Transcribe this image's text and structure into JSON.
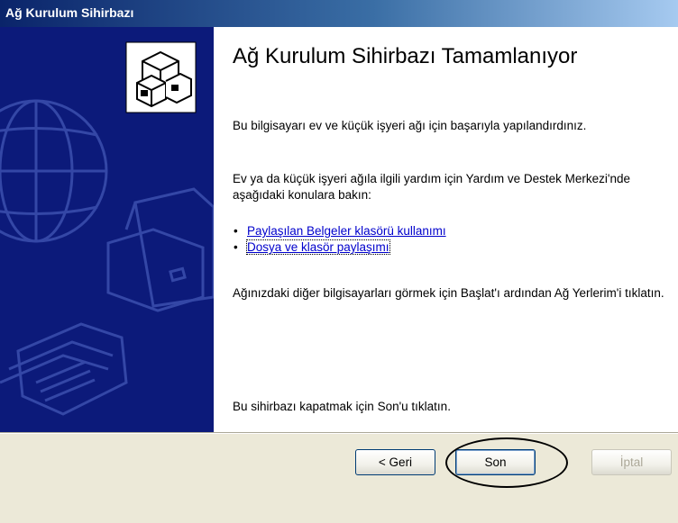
{
  "window": {
    "title": "Ağ Kurulum Sihirbazı"
  },
  "content": {
    "heading": "Ağ Kurulum Sihirbazı Tamamlanıyor",
    "paragraph1": "Bu bilgisayarı ev ve küçük işyeri ağı için başarıyla yapılandırdınız.",
    "paragraph2": "Ev ya da küçük işyeri ağıla ilgili yardım için Yardım ve Destek Merkezi'nde aşağıdaki konulara bakın:",
    "links": [
      {
        "label": "Paylaşılan Belgeler klasörü kullanımı",
        "bullet": "•"
      },
      {
        "label": "Dosya ve klasör paylaşımı",
        "bullet": "•"
      }
    ],
    "paragraph3": "Ağınızdaki diğer bilgisayarları görmek için Başlat'ı ardından Ağ Yerlerim'i tıklatın.",
    "paragraph4": "Bu sihirbazı kapatmak için Son'u tıklatın."
  },
  "buttons": {
    "back_label": "< Geri",
    "finish_label": "Son",
    "cancel_label": "İptal"
  },
  "icons": {
    "sidebar_graphic": "network-computers-icon",
    "globe": "globe-icon",
    "printer": "printer-icon",
    "folder": "folder-icon"
  },
  "colors": {
    "sidebar_bg": "#0c1a7a",
    "link": "#0000cc",
    "title_bar": "#0a246a"
  }
}
